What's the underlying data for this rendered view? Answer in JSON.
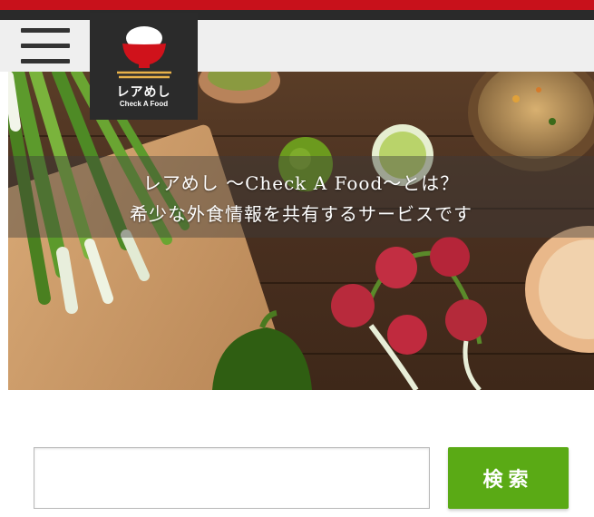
{
  "brand": {
    "name": "レアめし",
    "subtitle": "Check A Food"
  },
  "hero": {
    "line1": "レアめし 〜Check A Food〜とは？",
    "line2": "希少な外食情報を共有するサービスです"
  },
  "search": {
    "placeholder": "",
    "value": "",
    "button_label": "検索"
  },
  "colors": {
    "top_red": "#c8111b",
    "button_green": "#5aaa15",
    "logo_bg": "#2b2b2b"
  },
  "icons": {
    "menu": "hamburger-menu-icon",
    "logo": "rice-bowl-chopsticks-logo"
  }
}
